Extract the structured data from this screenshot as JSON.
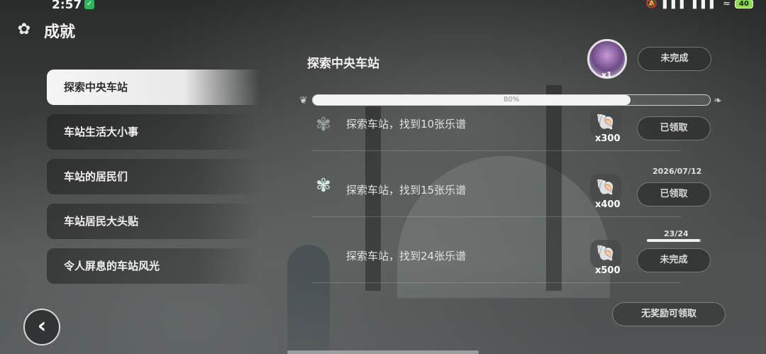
{
  "status_bar": {
    "time": "2:57",
    "signal_icons": "🔕 ▌▌▌ ▌▌▌ ≈",
    "battery": "40"
  },
  "header": {
    "title": "成就",
    "icon": "achievement-badge-icon"
  },
  "sidebar": {
    "items": [
      {
        "label": "探索中央车站",
        "active": true
      },
      {
        "label": "车站生活大小事",
        "active": false
      },
      {
        "label": "车站的居民们",
        "active": false
      },
      {
        "label": "车站居民大头贴",
        "active": false
      },
      {
        "label": "令人屏息的车站风光",
        "active": false
      }
    ]
  },
  "panel": {
    "title": "探索中央车站",
    "avatar_count": "x1",
    "status_button": "未完成",
    "progress": {
      "value": 0.8,
      "label": "80%"
    }
  },
  "achievements": [
    {
      "text": "探索车站，找到10张乐谱",
      "reward": "x300",
      "button": "已领取",
      "icon": "flower-badge-icon",
      "date": "",
      "progress_text": ""
    },
    {
      "text": "探索车站，找到15张乐谱",
      "reward": "x400",
      "button": "已领取",
      "icon": "flower-badge-icon",
      "date": "2026/07/12",
      "progress_text": ""
    },
    {
      "text": "探索车站，找到24张乐谱",
      "reward": "x500",
      "button": "未完成",
      "icon": "",
      "date": "",
      "progress_text": "23/24",
      "progress_value": 0.958
    }
  ],
  "footer": {
    "claim_button": "无奖励可领取"
  }
}
